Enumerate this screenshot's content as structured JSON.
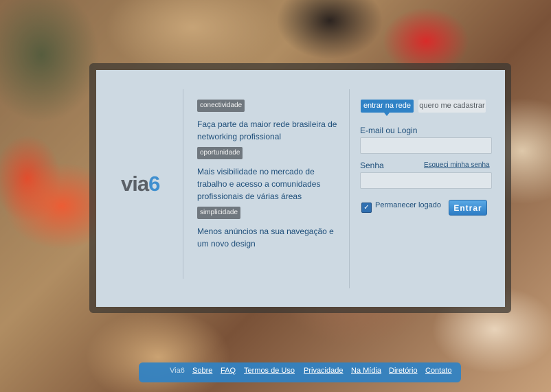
{
  "logo": {
    "text_main": "via",
    "text_accent": "6"
  },
  "features": [
    {
      "tag": "conectividade",
      "description": "Faça parte da maior rede brasileira de networking profissional"
    },
    {
      "tag": "oportunidade",
      "description": "Mais visibilidade no mercado de trabalho e acesso a comunidades profissionais de várias áreas"
    },
    {
      "tag": "simplicidade",
      "description": "Menos anúncios na sua navegação e um novo design"
    }
  ],
  "login": {
    "tabs": {
      "active": "entrar na rede",
      "inactive": "quero me cadastrar"
    },
    "email_label": "E-mail ou Login",
    "email_value": "",
    "password_label": "Senha",
    "password_value": "",
    "forgot_link": "Esqueci minha senha",
    "remember_label": "Permanecer logado",
    "remember_checked": true,
    "submit_label": "Entrar"
  },
  "footer": {
    "brand": "Via6",
    "links": [
      "Sobre",
      "FAQ",
      "Termos de Uso",
      "Privacidade",
      "Na Mídia",
      "Diretório",
      "Contato"
    ]
  },
  "colors": {
    "accent": "#2f82c6",
    "panel": "#cdd9e2",
    "text": "#1f4f7a"
  }
}
